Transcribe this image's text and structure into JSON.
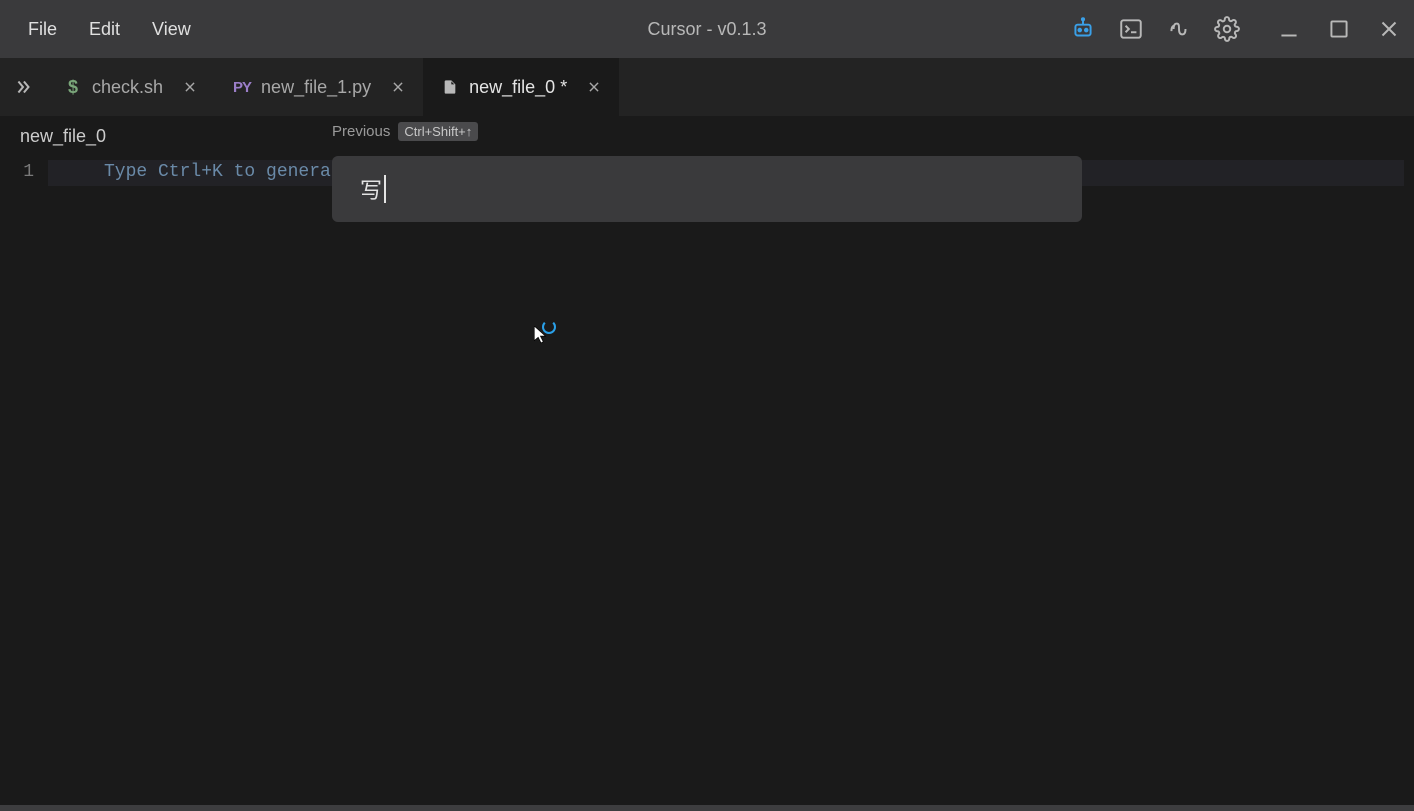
{
  "menu": {
    "file": "File",
    "edit": "Edit",
    "view": "View"
  },
  "app_title": "Cursor - v0.1.3",
  "tabs": [
    {
      "label": "check.sh",
      "icon": "dollar",
      "active": false
    },
    {
      "label": "new_file_1.py",
      "icon": "py",
      "active": false
    },
    {
      "label": "new_file_0 *",
      "icon": "file",
      "active": true
    }
  ],
  "breadcrumb": {
    "path": "new_file_0"
  },
  "previous_hint": {
    "label": "Previous",
    "shortcut": "Ctrl+Shift+↑"
  },
  "editor": {
    "line_number": "1",
    "placeholder_line": "Type Ctrl+K to generat"
  },
  "palette": {
    "value": "写"
  }
}
